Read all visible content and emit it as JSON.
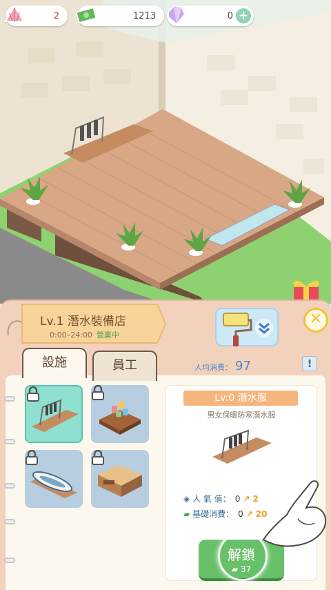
{
  "currency": {
    "shells": "2",
    "cash": "1213",
    "gems": "0"
  },
  "shop": {
    "title": "Lv.1 潛水裝備店",
    "hours": "0:00–24:00",
    "status": "營業中"
  },
  "tabs": {
    "facility": "設施",
    "staff": "員工"
  },
  "avg_spend": {
    "label": "人均消費：",
    "value": "97"
  },
  "info_label": "!",
  "close_label": "✕",
  "facilities": [
    {
      "name": "wetsuit-rack",
      "selected": true,
      "locked": true
    },
    {
      "name": "snorkel-display",
      "selected": false,
      "locked": true
    },
    {
      "name": "surfboard",
      "selected": false,
      "locked": true
    },
    {
      "name": "counter-table",
      "selected": false,
      "locked": true
    }
  ],
  "detail": {
    "title": "Lv:0 潛水服",
    "desc": "男女保暖防寒潛水服",
    "pop_label": "人 氣 值：",
    "pop_value": "0",
    "pop_arrow_value": "2",
    "base_label": "基礎消費：",
    "base_value": "0",
    "base_arrow_value": "20"
  },
  "unlock": {
    "label": "解鎖",
    "cost": "37"
  },
  "colors": {
    "panel": "#f2d2bd",
    "accent_green": "#68c06a",
    "selected_card": "#8fe0d0"
  }
}
